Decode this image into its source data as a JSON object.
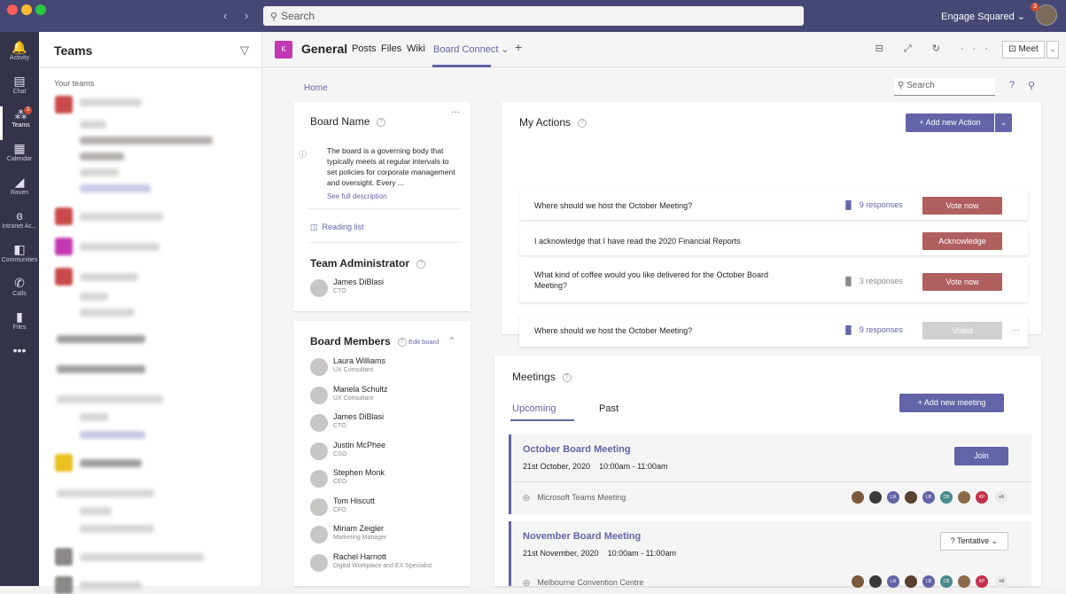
{
  "titlebar": {
    "search_placeholder": "Search",
    "org_name": "Engage Squared",
    "org_chevron": "⌄",
    "notification_count": "3"
  },
  "rail": [
    {
      "label": "Activity",
      "icon": "bell-icon",
      "glyph": "🔔"
    },
    {
      "label": "Chat",
      "icon": "chat-icon",
      "glyph": "▤"
    },
    {
      "label": "Teams",
      "icon": "teams-icon",
      "glyph": "⁂",
      "badge": "3"
    },
    {
      "label": "Calendar",
      "icon": "calendar-icon",
      "glyph": "▦"
    },
    {
      "label": "Raven",
      "icon": "raven-icon",
      "glyph": "◢"
    },
    {
      "label": "Intranet Ac...",
      "icon": "intranet-icon",
      "glyph": "ɞ"
    },
    {
      "label": "Communities",
      "icon": "communities-icon",
      "glyph": "◧"
    },
    {
      "label": "Calls",
      "icon": "phone-icon",
      "glyph": "✆"
    },
    {
      "label": "Files",
      "icon": "files-icon",
      "glyph": "▮"
    },
    {
      "label": "",
      "icon": "more-icon",
      "glyph": "•••"
    }
  ],
  "teams_panel": {
    "title": "Teams",
    "section_label": "Your teams"
  },
  "channel": {
    "icon_text": "K",
    "name": "General",
    "tabs": [
      "Posts",
      "Files",
      "Wiki",
      "Board Connect ⌄"
    ],
    "add_tab": "+",
    "meet_label": "⊡ Meet",
    "meet_dropdown": "⌄",
    "header_icons": "⊟ ⤢ ↻ ···"
  },
  "app": {
    "home_link": "Home",
    "search_placeholder": "Search",
    "help": "?",
    "person": "⚲"
  },
  "board": {
    "title": "Board Name",
    "more": "···",
    "description": "The board is a governing body that typically meets at regular intervals to set policies for corporate management and oversight. Every ...",
    "see_full": "See full description",
    "reading_list": "Reading list",
    "admin_title": "Team Administrator",
    "admin": {
      "name": "James DiBlasi",
      "role": "CTO"
    }
  },
  "members": {
    "title": "Board Members",
    "edit_link": "Edit board",
    "collapse": "^",
    "list": [
      {
        "name": "Laura Williams",
        "role": "UX Consultant"
      },
      {
        "name": "Mariela Schultz",
        "role": "UX Consultant"
      },
      {
        "name": "James DiBlasi",
        "role": "CTO"
      },
      {
        "name": "Justin McPhee",
        "role": "CSO"
      },
      {
        "name": "Stephen Monk",
        "role": "CEO"
      },
      {
        "name": "Tom Hiscutt",
        "role": "CFO"
      },
      {
        "name": "Miriam Zeigler",
        "role": "Marketing Manager"
      },
      {
        "name": "Rachel Harnott",
        "role": "Digital Workplace and EX Specialist"
      }
    ]
  },
  "actions": {
    "title": "My Actions",
    "add_label": "+ Add new Action",
    "add_dropdown": "⌄",
    "items": [
      {
        "text": "Where should we host the October Meeting?",
        "responses": "9 responses",
        "button": "Vote now",
        "state": "active",
        "resp_color": "#6264a7"
      },
      {
        "text": "I acknowledge that I have read the 2020 Financial Reports",
        "responses": "",
        "button": "Acknowledge",
        "state": "active",
        "resp_color": "#6264a7"
      },
      {
        "text": "What kind of coffee would you like delivered for the October Board Meeting?",
        "responses": "3 responses",
        "button": "Vote now",
        "state": "active",
        "resp_color": "#8a8886"
      },
      {
        "text": "Where should we host the October Meeting?",
        "responses": "9 responses",
        "button": "Voted",
        "state": "done",
        "resp_color": "#6264a7",
        "more": "···"
      }
    ]
  },
  "meetings": {
    "title": "Meetings",
    "tabs": [
      "Upcoming",
      "Past"
    ],
    "add_label": "+ Add new meeting",
    "items": [
      {
        "title": "October Board Meeting",
        "date": "21st October, 2020",
        "time": "10:00am - 11:00am",
        "button": "Join",
        "location": "Microsoft Teams Meeting",
        "extra": "+9"
      },
      {
        "title": "November Board Meeting",
        "date": "21st November, 2020",
        "time": "10:00am - 11:00am",
        "button": "? Tentative ⌄",
        "location": "Melbourne Convention Centre",
        "extra": "+9"
      }
    ],
    "attendee_initials": [
      "",
      "",
      "LR",
      "",
      "LB",
      "CB",
      "",
      "KP"
    ]
  },
  "colors": {
    "brand": "#6264a7",
    "titlebar": "#464775",
    "rail": "#33344a",
    "action_button": "#b05e5e",
    "voted_button": "#d2d0ce"
  }
}
